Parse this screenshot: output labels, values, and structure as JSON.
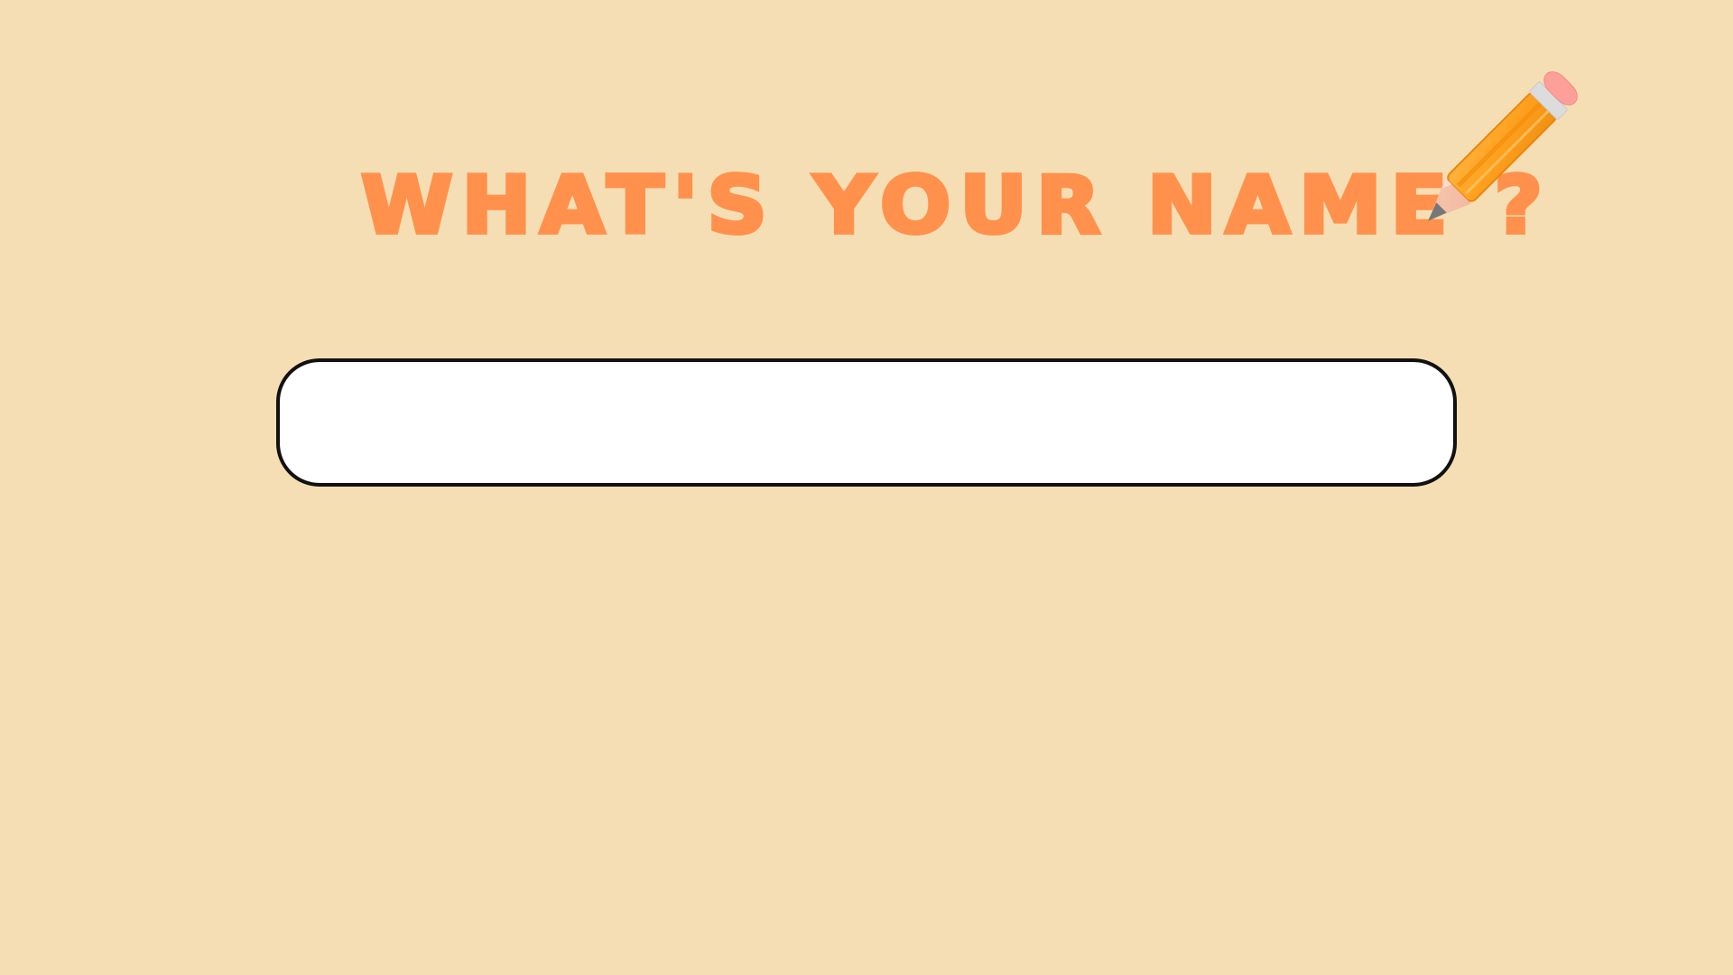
{
  "screen": {
    "background_color": "#f5deb3"
  },
  "prompt": {
    "title": "WHAT'S YOUR NAME ?",
    "title_color": "#ff914d"
  },
  "name_input": {
    "value": "",
    "placeholder": ""
  },
  "icons": {
    "pencil": "pencil-icon"
  }
}
